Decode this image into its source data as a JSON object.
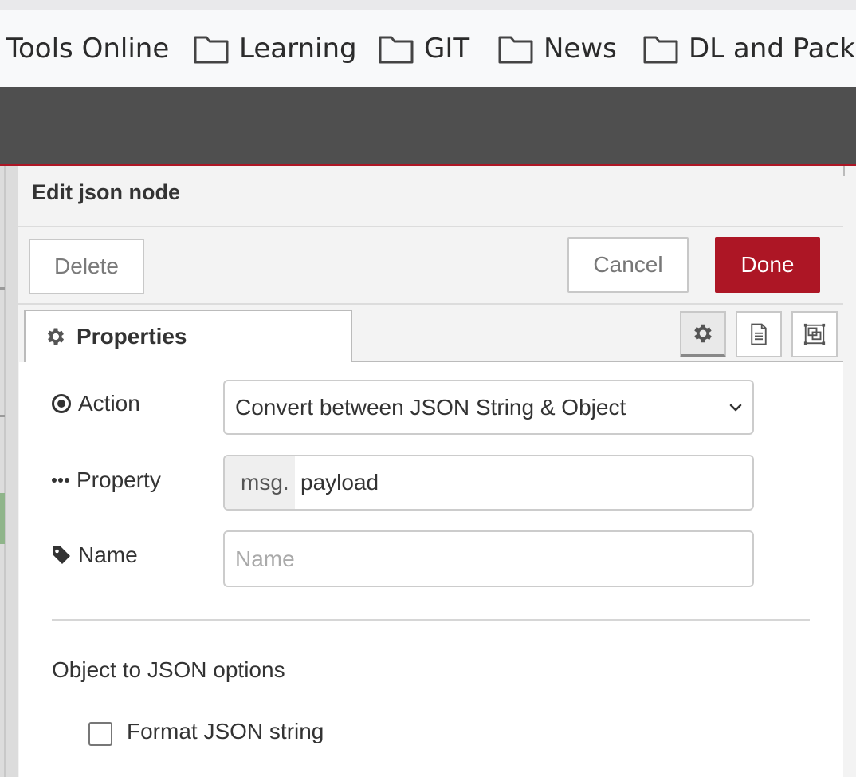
{
  "bookmarks": [
    {
      "label": "Tools Online",
      "icon": "none"
    },
    {
      "label": "Learning",
      "icon": "folder-icon"
    },
    {
      "label": "GIT",
      "icon": "folder-icon"
    },
    {
      "label": "News",
      "icon": "folder-icon"
    },
    {
      "label": "DL and Pack",
      "icon": "folder-icon"
    }
  ],
  "tray": {
    "title": "Edit json node",
    "delete_label": "Delete",
    "cancel_label": "Cancel",
    "done_label": "Done"
  },
  "tabs": {
    "properties_label": "Properties",
    "icon_buttons": [
      "gear-icon",
      "description-icon",
      "appearance-icon"
    ]
  },
  "form": {
    "action_label": "Action",
    "action_value": "Convert between JSON String & Object",
    "property_label": "Property",
    "property_prefix": "msg.",
    "property_value": "payload",
    "name_label": "Name",
    "name_placeholder": "Name",
    "name_value": ""
  },
  "options": {
    "section_title": "Object to JSON options",
    "format_label": "Format JSON string",
    "format_checked": false
  },
  "colors": {
    "accent": "#ad1625",
    "header": "#4f4f4f"
  }
}
